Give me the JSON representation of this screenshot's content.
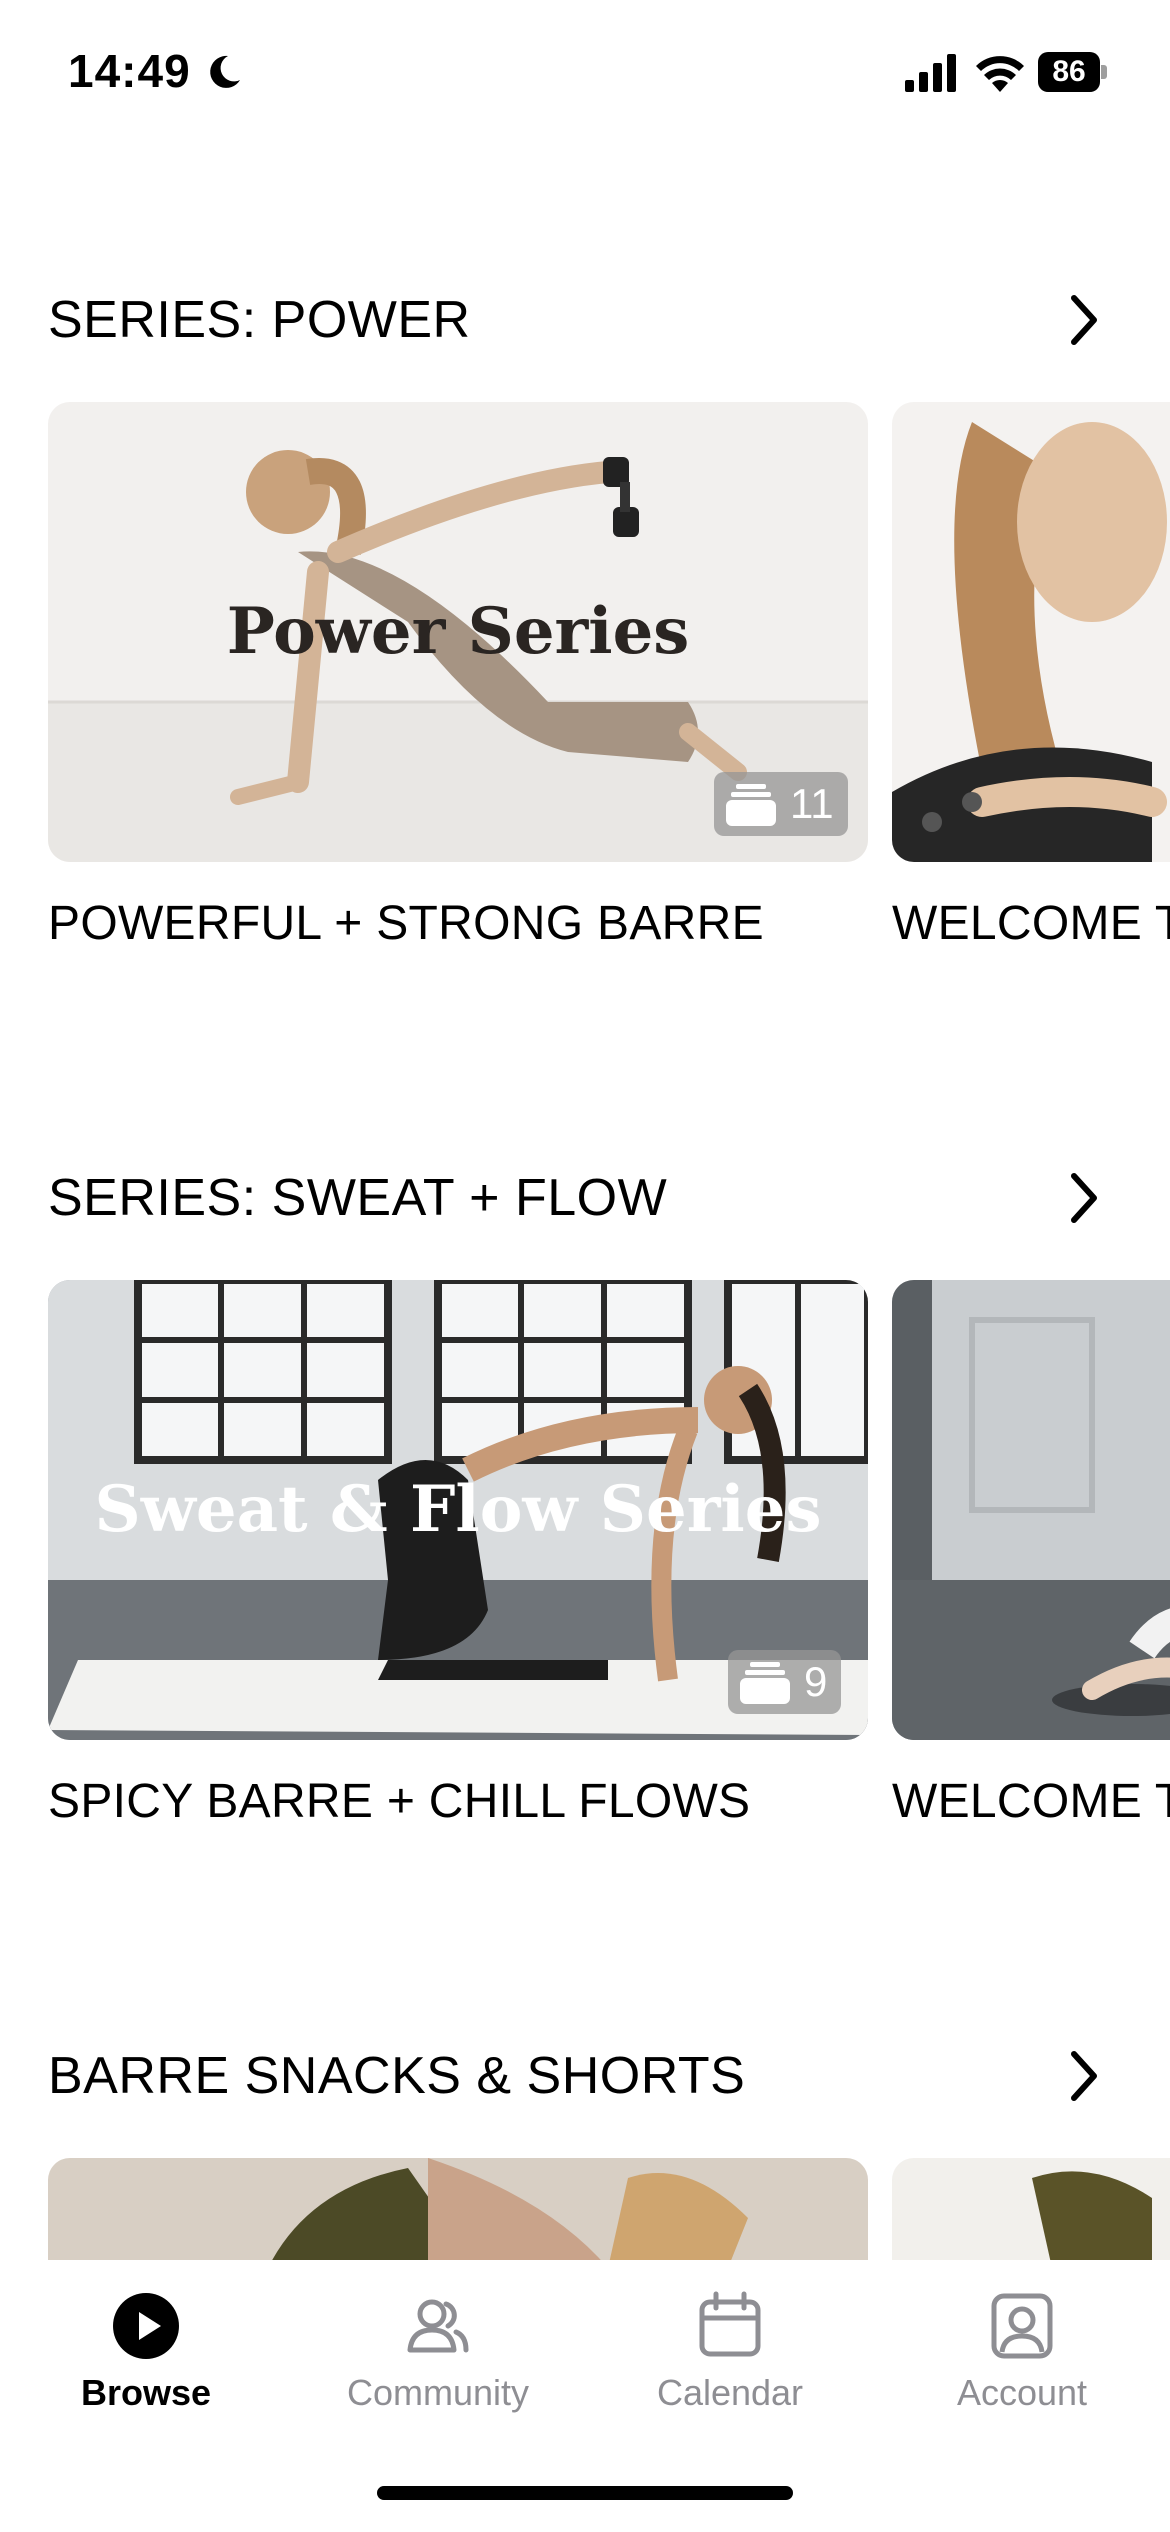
{
  "status_bar": {
    "time": "14:49",
    "battery": "86"
  },
  "sections": [
    {
      "title": "SERIES: POWER",
      "cards": [
        {
          "overlay": "Power Series",
          "count": "11",
          "caption": "POWERFUL + STRONG BARRE"
        },
        {
          "caption": "WELCOME T"
        }
      ]
    },
    {
      "title": "SERIES: SWEAT + FLOW",
      "cards": [
        {
          "overlay": "Sweat & Flow Series",
          "count": "9",
          "caption": "SPICY BARRE + CHILL FLOWS"
        },
        {
          "caption": "WELCOME T"
        }
      ]
    },
    {
      "title": "BARRE SNACKS & SHORTS",
      "cards": [
        {},
        {}
      ]
    }
  ],
  "tabbar": {
    "active": "Browse",
    "tabs": [
      {
        "label": "Browse",
        "icon": "play-circle-icon"
      },
      {
        "label": "Community",
        "icon": "people-icon"
      },
      {
        "label": "Calendar",
        "icon": "calendar-icon"
      },
      {
        "label": "Account",
        "icon": "account-icon"
      }
    ]
  },
  "colors": {
    "active_tab": "#000000",
    "inactive_tab": "#8e8e93",
    "badge_bg": "#969696"
  }
}
